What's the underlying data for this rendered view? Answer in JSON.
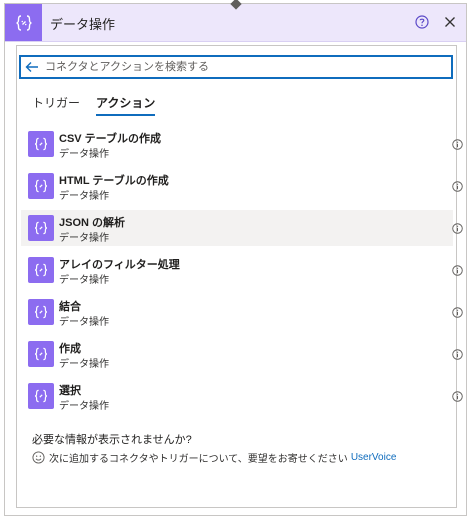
{
  "header": {
    "title": "データ操作",
    "icon": "curly-braces-icon",
    "help_icon": "help-circle-icon",
    "close_icon": "close-icon",
    "accent_color": "#8c6cf0",
    "background_color": "#ede7fb"
  },
  "search": {
    "placeholder": "コネクタとアクションを検索する",
    "value": "",
    "back_icon": "back-arrow-icon"
  },
  "tabs": [
    {
      "label": "トリガー",
      "active": false
    },
    {
      "label": "アクション",
      "active": true
    }
  ],
  "actions": [
    {
      "name": "CSV テーブルの作成",
      "category": "データ操作"
    },
    {
      "name": "HTML テーブルの作成",
      "category": "データ操作"
    },
    {
      "name": "JSON の解析",
      "category": "データ操作",
      "highlighted": true
    },
    {
      "name": "アレイのフィルター処理",
      "category": "データ操作"
    },
    {
      "name": "結合",
      "category": "データ操作"
    },
    {
      "name": "作成",
      "category": "データ操作"
    },
    {
      "name": "選択",
      "category": "データ操作"
    }
  ],
  "footer": {
    "missing_title": "必要な情報が表示されませんか?",
    "feedback_text": "次に追加するコネクタやトリガーについて、要望をお寄せください",
    "feedback_link": "UserVoice",
    "link_color": "#0f6cbd"
  }
}
